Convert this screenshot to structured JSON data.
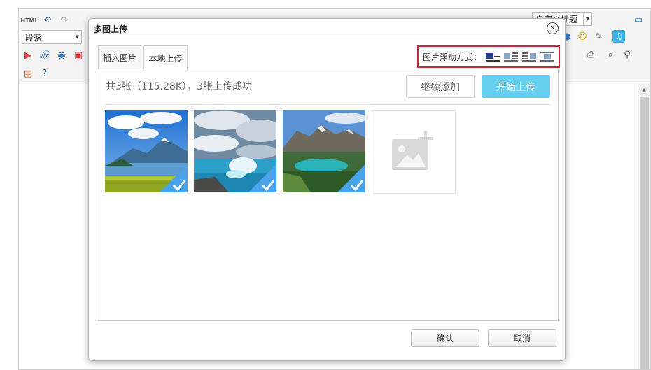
{
  "editor": {
    "toolbar": {
      "html_label": "HTML",
      "paragraph_select": "段落",
      "heading_select": "自定义标题"
    }
  },
  "dialog": {
    "title": "多图上传",
    "close_glyph": "✕",
    "tabs": [
      {
        "label": "插入图片",
        "active": false
      },
      {
        "label": "本地上传",
        "active": true
      }
    ],
    "float_label": "图片浮动方式：",
    "float_icons": [
      "float-none-icon",
      "float-left-icon",
      "float-right-icon",
      "float-center-icon"
    ],
    "status": "共3张（115.28K），3张上传成功",
    "add_more_label": "继续添加",
    "start_upload_label": "开始上传",
    "images": [
      {
        "name": "lake-mountain-image",
        "uploaded": true
      },
      {
        "name": "sea-clouds-image",
        "uploaded": true
      },
      {
        "name": "glacier-lake-image",
        "uploaded": true
      }
    ],
    "ok_label": "确认",
    "cancel_label": "取消"
  },
  "colors": {
    "accent": "#66d0f1",
    "highlight_border": "#c9282d",
    "check_badge": "#4aa3e8"
  }
}
